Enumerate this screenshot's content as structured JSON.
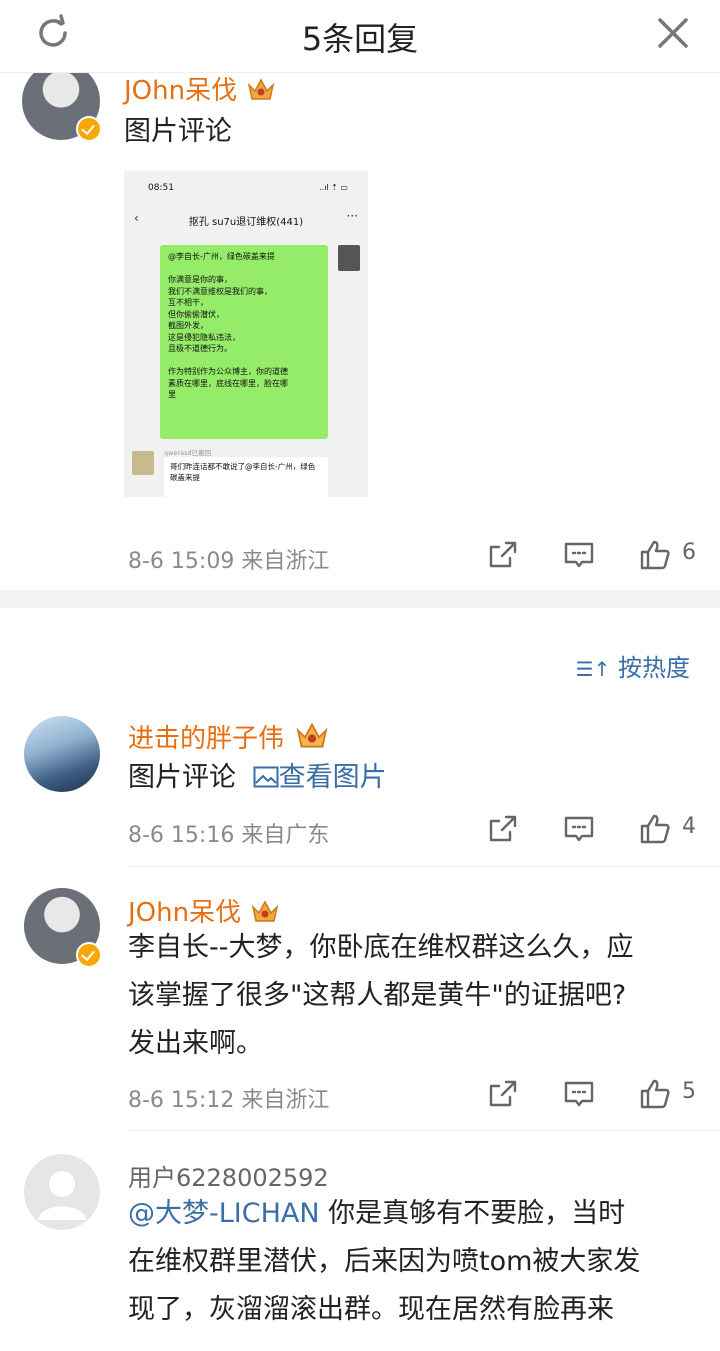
{
  "header": {
    "title": "5条回复"
  },
  "main_comment": {
    "username": "JOhn呆伐",
    "text": "图片评论",
    "meta": "8-6 15:09  来自浙江",
    "likes": "6",
    "screenshot": {
      "time": "08:51",
      "status_icons": "..ıl ⇡ ▭",
      "group_title": "抠孔 su7u退订维权(441)",
      "bubble_lines": [
        "@李自长-广州，绿色碳盖来提",
        "",
        "你满意是你的事，",
        "我们不满意维权是我们的事，",
        "互不相干，",
        "但你偷偷潜伏，",
        "截图外发，",
        "这是侵犯隐私违法，",
        "且极不道德行为。",
        "",
        "作为特别作为公众博主，你的道德",
        "素质在哪里，底线在哪里，脸在哪",
        "里"
      ],
      "reply_nick": "qwerasd已撤回",
      "reply_text": "哥们昨连话都不敢说了@李自长-广州，绿色碳盖来提"
    }
  },
  "sort_label": "按热度",
  "replies": [
    {
      "username": "进击的胖子伟",
      "text": "图片评论",
      "view_image": "查看图片",
      "meta": "8-6 15:16  来自广东",
      "likes": "4"
    },
    {
      "username": "JOhn呆伐",
      "text_lines": [
        "李自长--大梦，你卧底在维权群这么久，应",
        "该掌握了很多\"这帮人都是黄牛\"的证据吧?",
        "发出来啊。"
      ],
      "meta": "8-6 15:12  来自浙江",
      "likes": "5"
    },
    {
      "username": "用户6228002592",
      "mention": "@大梦-LICHAN",
      "text_lines": [
        " 你是真够有不要脸，当时",
        "在维权群里潜伏，后来因为喷tom被大家发",
        "现了，灰溜溜滚出群。现在居然有脸再来"
      ]
    }
  ],
  "colors": {
    "username": "#e86e12",
    "link": "#3a6ea5",
    "meta": "#8a8a8a",
    "bubble": "#95ec69"
  }
}
